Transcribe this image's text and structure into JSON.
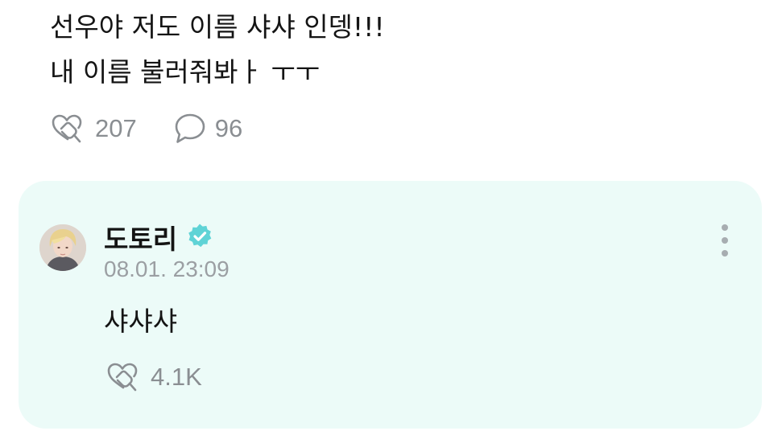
{
  "post": {
    "lines": [
      "선우야 저도 이름 샤샤 인뎅!!!",
      "내 이름 불러줘봐ㅏ ㅜㅜ"
    ],
    "reactions": "207",
    "comments": "96",
    "icons": {
      "reactions": "heart-hand-icon",
      "comments": "speech-bubble-icon"
    }
  },
  "reply": {
    "author": "도토리",
    "verified": true,
    "timestamp": "08.01. 23:09",
    "text": "샤샤샤",
    "reactions": "4.1K",
    "icons": {
      "verified": "verified-badge-icon",
      "menu": "more-vertical-icon",
      "reactions": "heart-hand-icon"
    }
  },
  "colors": {
    "card_background": "#ecfbf8",
    "verified_badge": "#5fd3d6",
    "muted_text": "#8a8e92"
  }
}
